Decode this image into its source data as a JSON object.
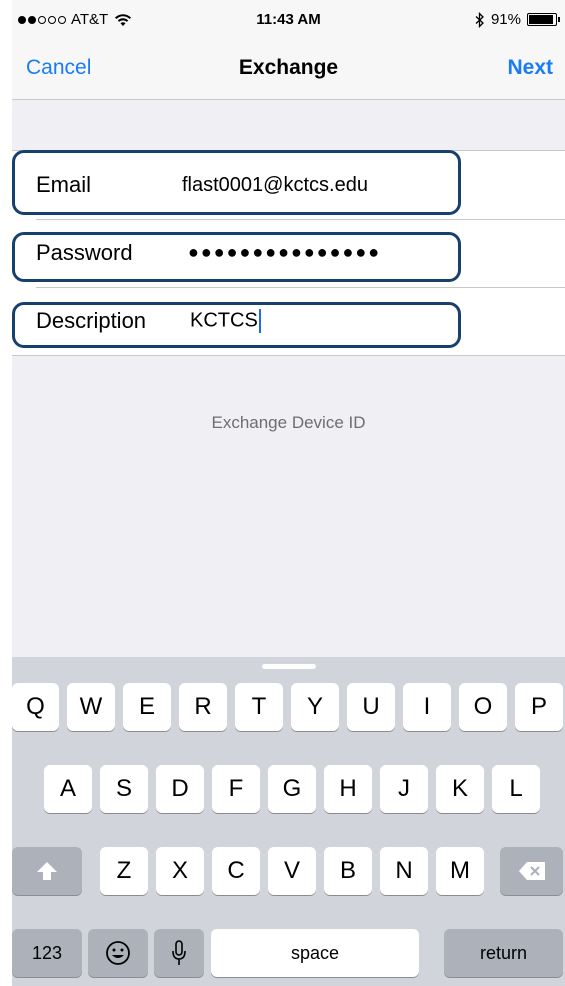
{
  "status_bar": {
    "carrier": "AT&T",
    "time": "11:43 AM",
    "battery": "91%",
    "battery_level": 0.91,
    "signal_bars": 2,
    "signal_total": 5
  },
  "nav": {
    "cancel": "Cancel",
    "title": "Exchange",
    "next": "Next"
  },
  "form": {
    "email_label": "Email",
    "email_value": "flast0001@kctcs.edu",
    "password_label": "Password",
    "password_value": "●●●●●●●●●●●●●●●",
    "description_label": "Description",
    "description_value": "KCTCS"
  },
  "device_id": "Exchange Device ID",
  "keyboard": {
    "row1": [
      "Q",
      "W",
      "E",
      "R",
      "T",
      "Y",
      "U",
      "I",
      "O",
      "P"
    ],
    "row2": [
      "A",
      "S",
      "D",
      "F",
      "G",
      "H",
      "J",
      "K",
      "L"
    ],
    "row3": [
      "Z",
      "X",
      "C",
      "V",
      "B",
      "N",
      "M"
    ],
    "numbers": "123",
    "space": "space",
    "return": "return"
  },
  "colors": {
    "accent": "#1a7cf5",
    "highlight": "#17406d"
  }
}
